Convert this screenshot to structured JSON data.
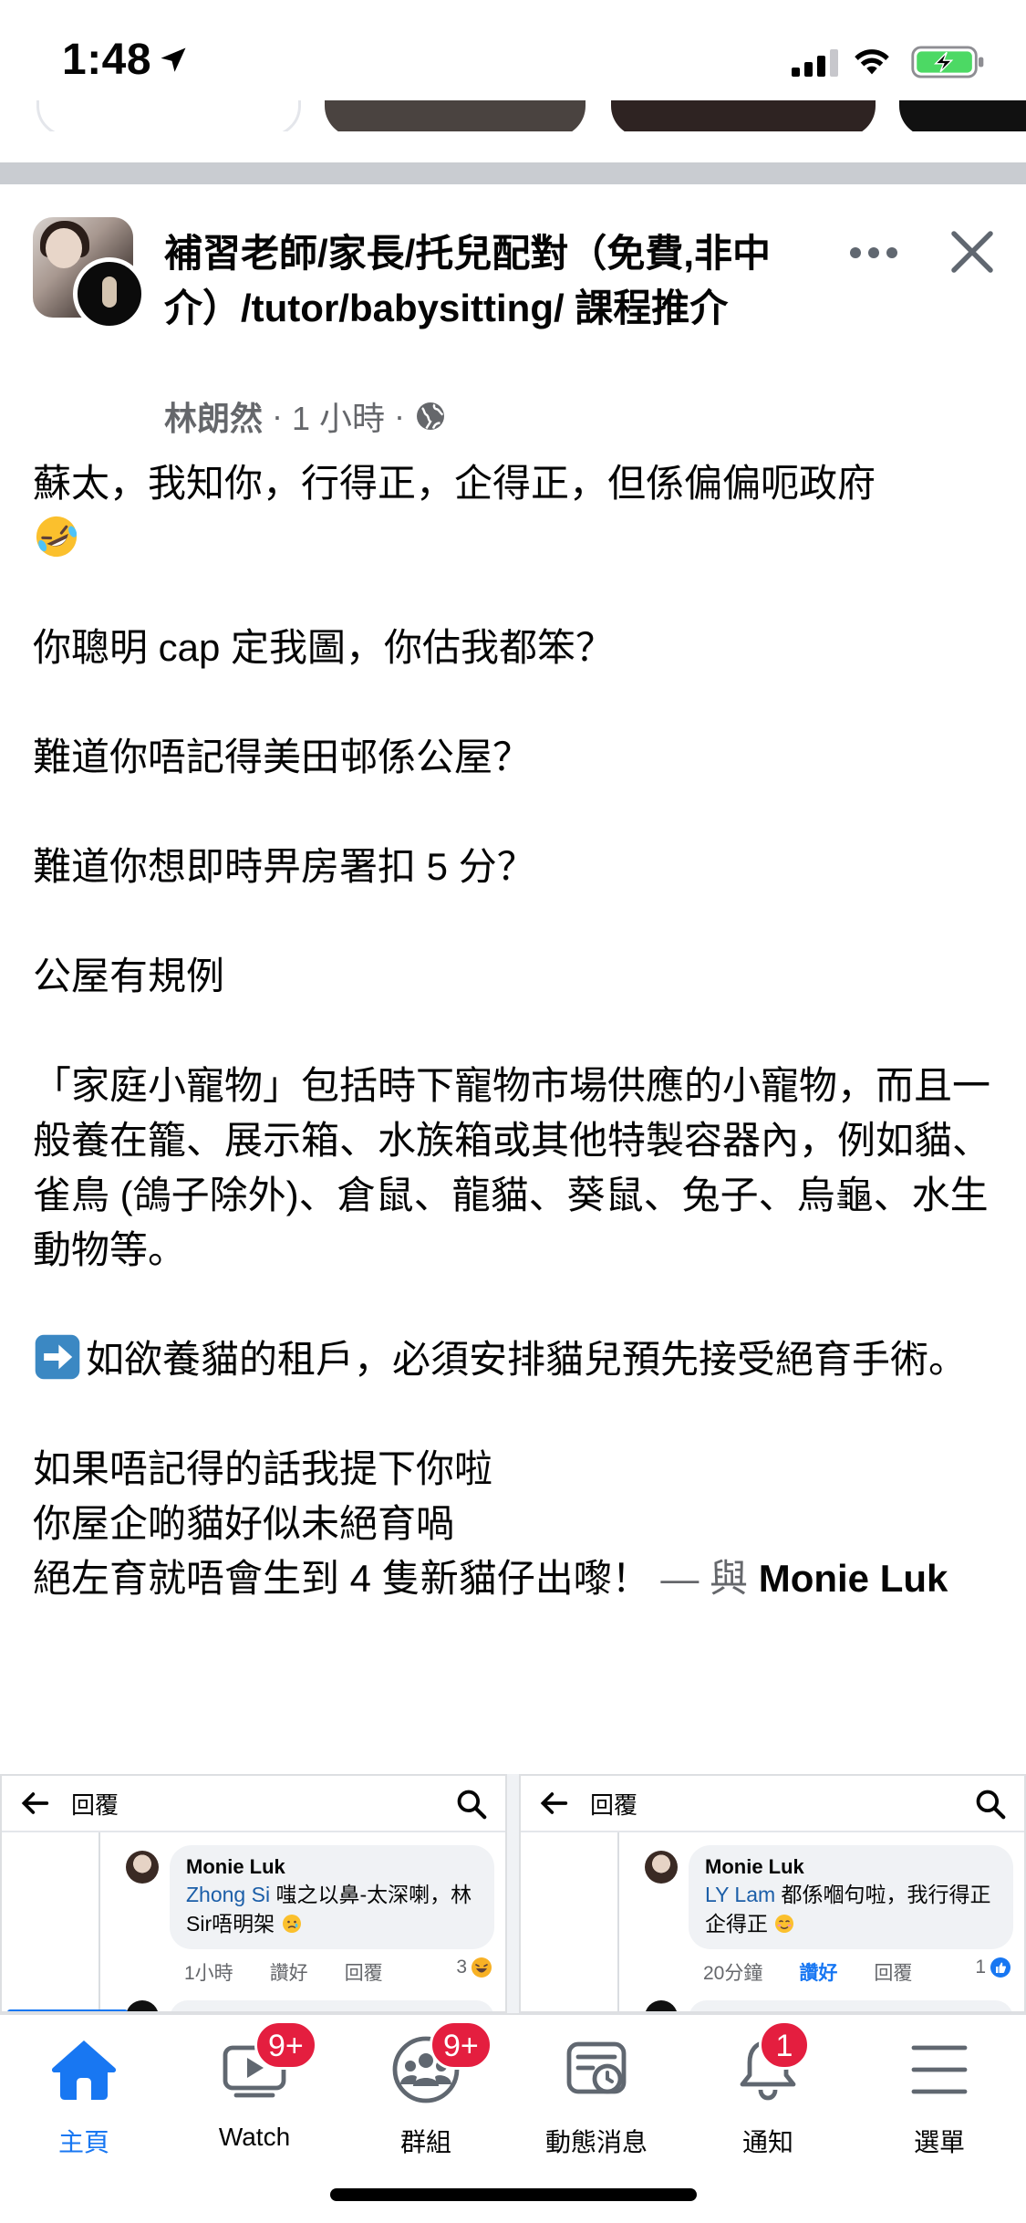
{
  "status_bar": {
    "time": "1:48"
  },
  "post": {
    "group_name": "補習老師/家長/托兒配對（免費,非中介）/tutor/babysitting/ 課程推介",
    "author": "林朗然",
    "time_ago": "1 小時",
    "meta_sep": "·",
    "lines": {
      "l1": "蘇太，我知你，行得正，企得正，但係偏偏呃政府",
      "l2": "你聰明 cap 定我圖，你估我都笨？",
      "l3": "難道你唔記得美田邨係公屋？",
      "l4": "難道你想即時畀房署扣 5 分？",
      "l5": "公屋有規例",
      "l6": "「家庭小寵物」包括時下寵物市場供應的小寵物，而且一般養在籠、展示箱、水族箱或其他特製容器內，例如貓、雀鳥 (鴿子除外)、倉鼠、龍貓、葵鼠、兔子、烏龜、水生動物等。",
      "l7": "如欲養貓的租戶，必須安排貓兒預先接受絕育手術。",
      "l8": "如果唔記得的話我提下你啦",
      "l9": "你屋企啲貓好似未絕育喎",
      "l10": "絕左育就唔會生到 4 隻新貓仔出嚟！",
      "with_sep": " — 與 ",
      "tagged": "Monie Luk"
    }
  },
  "previews": [
    {
      "header_label": "回覆",
      "commenter": "Monie Luk",
      "mention": "Zhong Si",
      "text": " 嗤之以鼻-太深喇，林Sir唔明架",
      "time": "1小時",
      "like_label": "讚好",
      "reply_label": "回覆",
      "reaction_count": "3",
      "liked": false
    },
    {
      "header_label": "回覆",
      "commenter": "Monie Luk",
      "mention": "LY Lam",
      "text": " 都係嗰句啦，我行得正企得正",
      "time": "20分鐘",
      "like_label": "讚好",
      "reply_label": "回覆",
      "reaction_count": "1",
      "liked": true
    }
  ],
  "tab_bar": {
    "tabs": [
      {
        "label": "主頁",
        "icon": "home-icon",
        "active": true,
        "badge": ""
      },
      {
        "label": "Watch",
        "icon": "watch-icon",
        "active": false,
        "badge": "9+"
      },
      {
        "label": "群組",
        "icon": "groups-icon",
        "active": false,
        "badge": "9+"
      },
      {
        "label": "動態消息",
        "icon": "news-feed-icon",
        "active": false,
        "badge": ""
      },
      {
        "label": "通知",
        "icon": "bell-icon",
        "active": false,
        "badge": "1"
      },
      {
        "label": "選單",
        "icon": "menu-icon",
        "active": false,
        "badge": ""
      }
    ]
  },
  "colors": {
    "accent": "#1877f2",
    "badge": "#e41e3f",
    "secondary_text": "#65676b"
  }
}
